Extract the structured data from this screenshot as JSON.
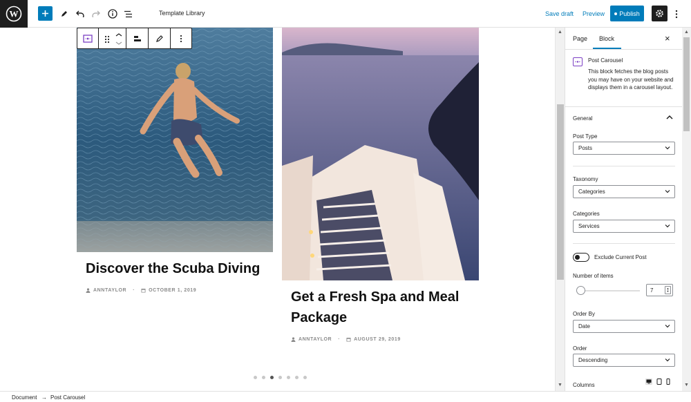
{
  "topbar": {
    "title": "Template Library",
    "save_draft": "Save draft",
    "preview": "Preview",
    "publish": "Publish"
  },
  "icons": {
    "logo": "wordpress-logo",
    "add": "plus-icon",
    "tools": "pencil-icon",
    "undo": "undo-icon",
    "redo": "redo-icon",
    "details": "info-icon",
    "outline": "list-view-icon",
    "settings": "gear-icon",
    "more": "kebab-menu-icon"
  },
  "canvas": {
    "posts": [
      {
        "title": "Discover the Scuba Diving",
        "author": "ANNTAYLOR",
        "separator": "·",
        "date": "OCTOBER 1, 2019"
      },
      {
        "title_line1": "Get a Fresh Spa and Meal",
        "title_line2": "Package",
        "author": "ANNTAYLOR",
        "separator": "·",
        "date": "AUGUST 29, 2019"
      }
    ],
    "carousel_dots": 7,
    "active_dot_index": 2
  },
  "sidebar": {
    "tabs": [
      "Page",
      "Block"
    ],
    "active_tab": "Block",
    "block": {
      "name": "Post Carousel",
      "description": "This block fetches the blog posts you may have on your website and displays them in a carousel layout."
    },
    "panel": "General",
    "fields": {
      "post_type": {
        "label": "Post Type",
        "value": "Posts"
      },
      "taxonomy": {
        "label": "Taxonomy",
        "value": "Categories"
      },
      "categories": {
        "label": "Categories",
        "value": "Services"
      },
      "exclude": {
        "label": "Exclude Current Post",
        "on": false
      },
      "number_of_items": {
        "label": "Number of items",
        "value": "7"
      },
      "order_by": {
        "label": "Order By",
        "value": "Date"
      },
      "order": {
        "label": "Order",
        "value": "Descending"
      },
      "columns": {
        "label": "Columns"
      }
    }
  },
  "footer": {
    "crumbs": [
      "Document",
      "→",
      "Post Carousel"
    ]
  },
  "colors": {
    "accent": "#007cba",
    "block_icon": "#7b3fc4",
    "dark": "#1e1e1e"
  }
}
